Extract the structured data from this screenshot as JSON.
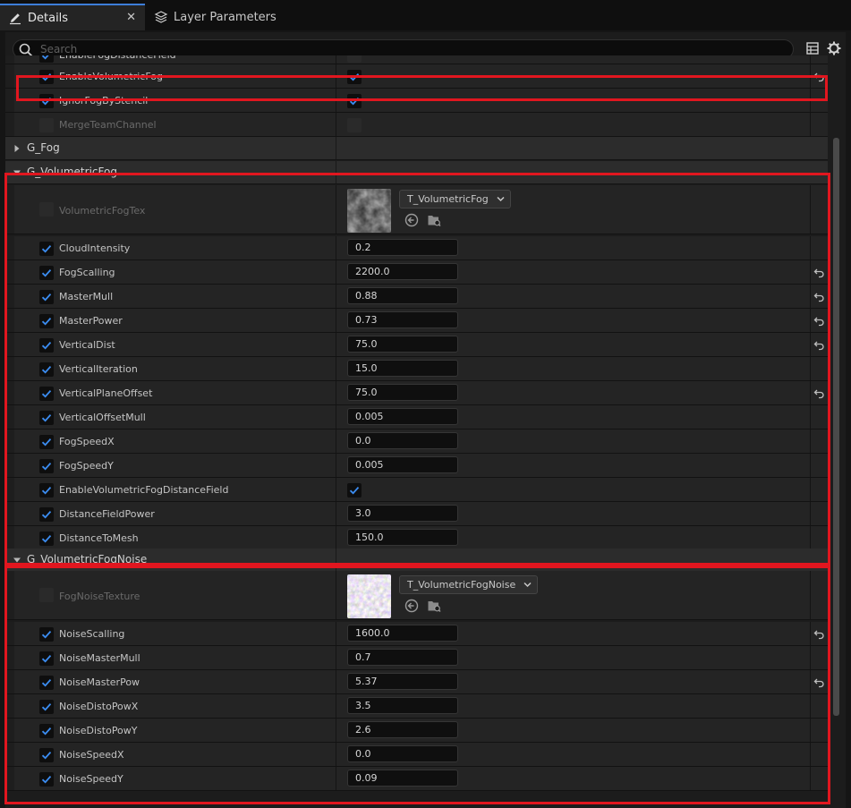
{
  "tabs": [
    {
      "label": "Details",
      "icon": "pencil-icon",
      "active": true
    },
    {
      "label": "Layer Parameters",
      "icon": "layers-icon",
      "active": false
    }
  ],
  "tab_close_glyph": "✕",
  "search": {
    "placeholder": "Search",
    "value": ""
  },
  "partial_row": {
    "label": "EnableFogDistanceField",
    "checked": true
  },
  "top_rows": [
    {
      "label": "EnableVolumetricFog",
      "checked": true,
      "bool_value": true,
      "override": true
    },
    {
      "label": "IgnorFogByStencil",
      "checked": true,
      "bool_value": true,
      "override": false
    },
    {
      "label": "MergeTeamChannel",
      "checked": false,
      "bool_value": false,
      "override": false,
      "disabled": true
    }
  ],
  "categories": {
    "fog": {
      "label": "G_Fog",
      "expanded": false
    },
    "volumetric_fog": {
      "label": "G_VolumetricFog",
      "expanded": true,
      "texture": {
        "label": "VolumetricFogTex",
        "asset": "T_VolumetricFog",
        "checked": false
      },
      "rows": [
        {
          "label": "CloudIntensity",
          "value": "0.2",
          "override": false
        },
        {
          "label": "FogScalling",
          "value": "2200.0",
          "override": true
        },
        {
          "label": "MasterMull",
          "value": "0.88",
          "override": true
        },
        {
          "label": "MasterPower",
          "value": "0.73",
          "override": true
        },
        {
          "label": "VerticalDist",
          "value": "75.0",
          "override": true
        },
        {
          "label": "VerticalIteration",
          "value": "15.0",
          "override": false
        },
        {
          "label": "VerticalPlaneOffset",
          "value": "75.0",
          "override": true
        },
        {
          "label": "VerticalOffsetMull",
          "value": "0.005",
          "override": false
        },
        {
          "label": "FogSpeedX",
          "value": "0.0",
          "override": false
        },
        {
          "label": "FogSpeedY",
          "value": "0.005",
          "override": false
        },
        {
          "label": "EnableVolumetricFogDistanceField",
          "bool": true,
          "override": false
        },
        {
          "label": "DistanceFieldPower",
          "value": "3.0",
          "override": false
        },
        {
          "label": "DistanceToMesh",
          "value": "150.0",
          "override": false
        }
      ]
    },
    "volumetric_fog_noise": {
      "label": "G_VolumetricFogNoise",
      "expanded": true,
      "texture": {
        "label": "FogNoiseTexture",
        "asset": "T_VolumetricFogNoise",
        "checked": false
      },
      "rows": [
        {
          "label": "NoiseScalling",
          "value": "1600.0",
          "override": true
        },
        {
          "label": "NoiseMasterMull",
          "value": "0.7",
          "override": false
        },
        {
          "label": "NoiseMasterPow",
          "value": "5.37",
          "override": true
        },
        {
          "label": "NoiseDistoPowX",
          "value": "3.5",
          "override": false
        },
        {
          "label": "NoiseDistoPowY",
          "value": "2.6",
          "override": false
        },
        {
          "label": "NoiseSpeedX",
          "value": "0.0",
          "override": false
        },
        {
          "label": "NoiseSpeedY",
          "value": "0.09",
          "override": false
        }
      ]
    }
  },
  "colors": {
    "accent": "#3d7ed9",
    "checkmark": "#3b8cf0",
    "highlight": "#e1161f",
    "panel": "#242424"
  }
}
